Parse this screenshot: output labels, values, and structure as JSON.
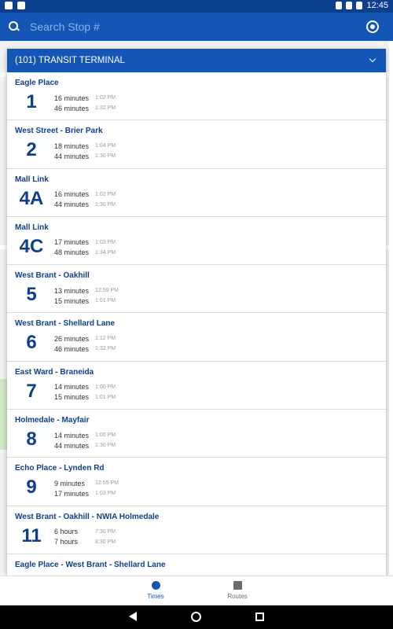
{
  "status_bar": {
    "time": "12:45"
  },
  "search": {
    "placeholder": "Search Stop #"
  },
  "panel": {
    "title": "(101) TRANSIT TERMINAL",
    "routes": [
      {
        "name": "Eagle Place",
        "number": "1",
        "times": [
          {
            "rel": "16 minutes",
            "abs": "1:02 PM"
          },
          {
            "rel": "46 minutes",
            "abs": "1:32 PM"
          }
        ]
      },
      {
        "name": "West Street - Brier Park",
        "number": "2",
        "times": [
          {
            "rel": "18 minutes",
            "abs": "1:04 PM"
          },
          {
            "rel": "44 minutes",
            "abs": "1:30 PM"
          }
        ]
      },
      {
        "name": "Mall Link",
        "number": "4A",
        "times": [
          {
            "rel": "16 minutes",
            "abs": "1:02 PM"
          },
          {
            "rel": "44 minutes",
            "abs": "1:30 PM"
          }
        ]
      },
      {
        "name": "Mall Link",
        "number": "4C",
        "times": [
          {
            "rel": "17 minutes",
            "abs": "1:03 PM"
          },
          {
            "rel": "48 minutes",
            "abs": "1:34 PM"
          }
        ]
      },
      {
        "name": "West Brant - Oakhill",
        "number": "5",
        "times": [
          {
            "rel": "13 minutes",
            "abs": "12:59 PM"
          },
          {
            "rel": "15 minutes",
            "abs": "1:01 PM"
          }
        ]
      },
      {
        "name": "West Brant - Shellard Lane",
        "number": "6",
        "times": [
          {
            "rel": "26 minutes",
            "abs": "1:12 PM"
          },
          {
            "rel": "46 minutes",
            "abs": "1:32 PM"
          }
        ]
      },
      {
        "name": "East Ward - Braneida",
        "number": "7",
        "times": [
          {
            "rel": "14 minutes",
            "abs": "1:00 PM"
          },
          {
            "rel": "15 minutes",
            "abs": "1:01 PM"
          }
        ]
      },
      {
        "name": "Holmedale - Mayfair",
        "number": "8",
        "times": [
          {
            "rel": "14 minutes",
            "abs": "1:00 PM"
          },
          {
            "rel": "44 minutes",
            "abs": "1:30 PM"
          }
        ]
      },
      {
        "name": "Echo Place - Lynden Rd",
        "number": "9",
        "times": [
          {
            "rel": "9 minutes",
            "abs": "12:55 PM"
          },
          {
            "rel": "17 minutes",
            "abs": "1:03 PM"
          }
        ]
      },
      {
        "name": "West Brant - Oakhill - NWIA Holmedale",
        "number": "11",
        "times": [
          {
            "rel": "6 hours",
            "abs": "7:30 PM"
          },
          {
            "rel": "7 hours",
            "abs": "8:30 PM"
          }
        ]
      },
      {
        "name": "Eagle Place - West Brant - Shellard Lane",
        "number": "",
        "times": []
      }
    ]
  },
  "bottom_nav": {
    "times_label": "Times",
    "routes_label": "Routes"
  },
  "colors": {
    "primary": "#1456b6",
    "dark": "#0d3f8f"
  }
}
